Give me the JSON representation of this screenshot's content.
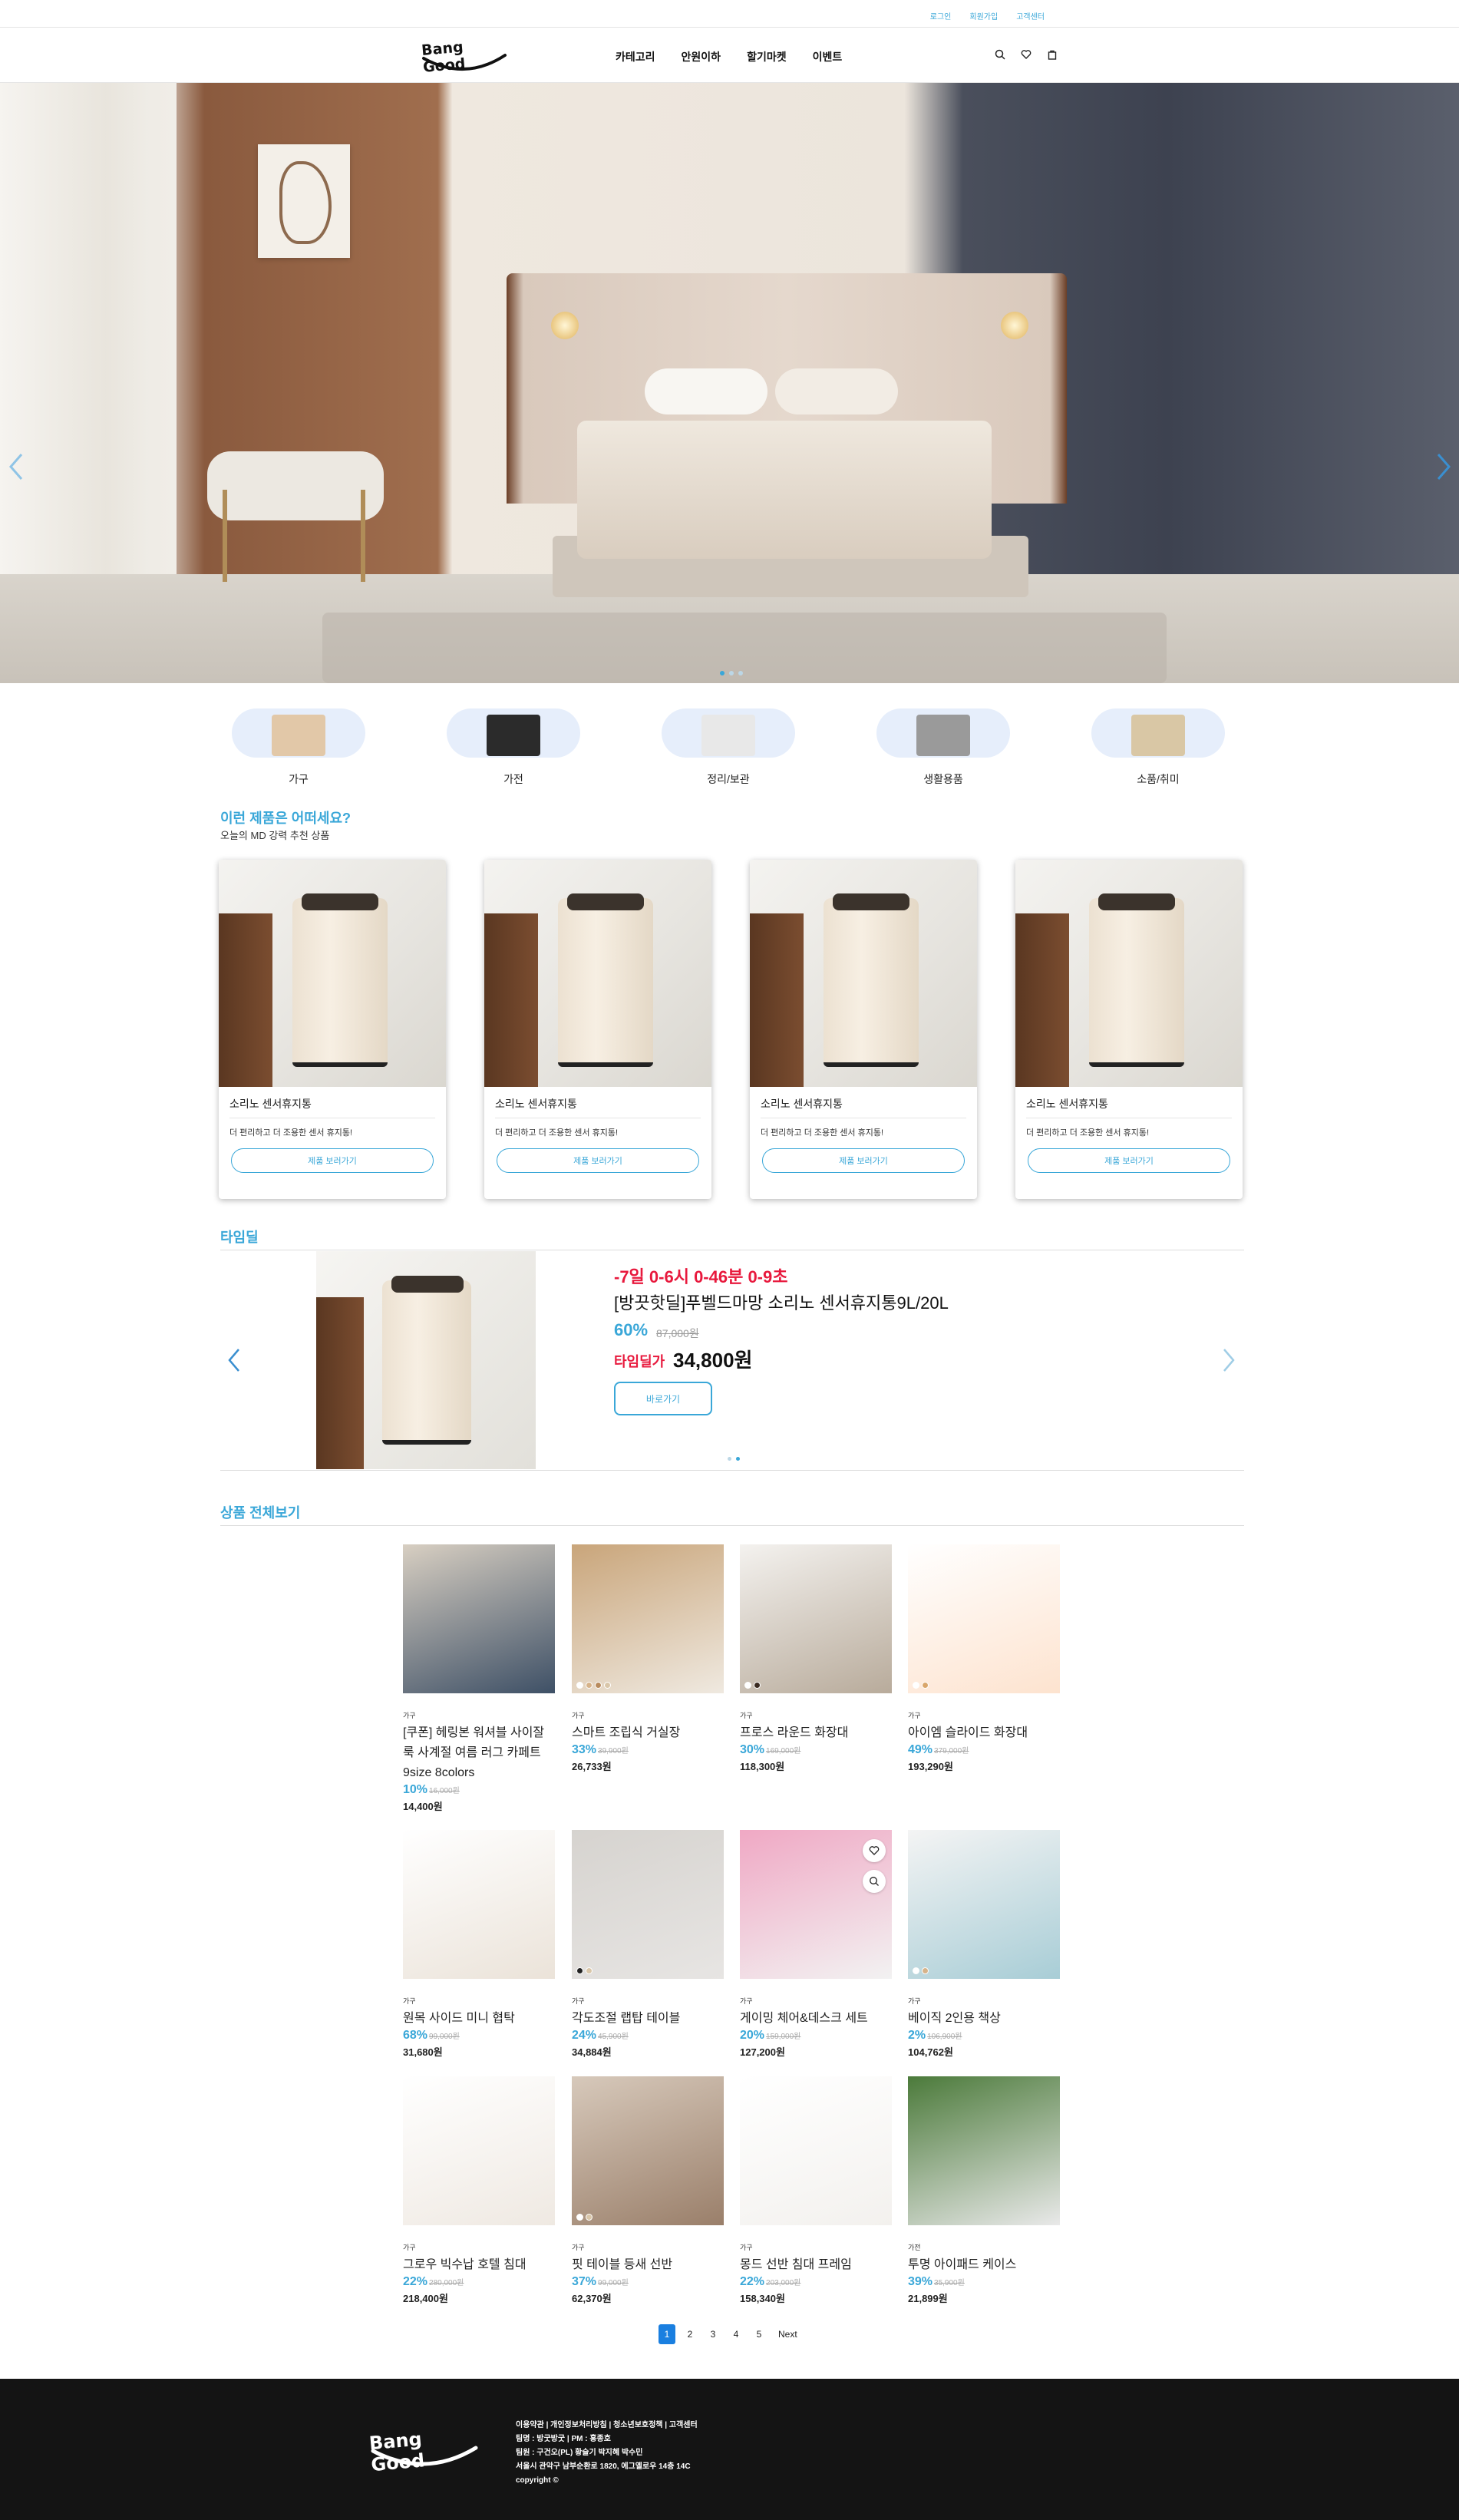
{
  "topbar": {
    "login": "로그인",
    "signup": "회원가입",
    "support": "고객센터"
  },
  "header": {
    "logo": "Bang Good",
    "nav": [
      "카테고리",
      "안원이하",
      "할기마켓",
      "이벤트"
    ],
    "icons": [
      "search-icon",
      "heart-icon",
      "bag-icon"
    ]
  },
  "hero": {
    "slides": 3,
    "active_slide": 1
  },
  "categories": [
    {
      "label": "가구",
      "color": "#e2c8a8"
    },
    {
      "label": "가전",
      "color": "#2b2b2b"
    },
    {
      "label": "정리/보관",
      "color": "#e8e8e8"
    },
    {
      "label": "생활용품",
      "color": "#9a9a9a"
    },
    {
      "label": "소품/취미",
      "color": "#d9c7a5"
    }
  ],
  "md": {
    "title": "이런 제품은 어떠세요?",
    "subtitle": "오늘의 MD 강력 추천 상품",
    "cards": [
      {
        "name": "소리노 센서휴지통",
        "desc": "더 편리하고 더 조용한 센서 휴지통!",
        "button": "제품 보러가기"
      },
      {
        "name": "소리노 센서휴지통",
        "desc": "더 편리하고 더 조용한 센서 휴지통!",
        "button": "제품 보러가기"
      },
      {
        "name": "소리노 센서휴지통",
        "desc": "더 편리하고 더 조용한 센서 휴지통!",
        "button": "제품 보러가기"
      },
      {
        "name": "소리노 센서휴지통",
        "desc": "더 편리하고 더 조용한 센서 휴지통!",
        "button": "제품 보러가기"
      }
    ]
  },
  "timedeal": {
    "title": "타임딜",
    "timer": "-7일 0-6시 0-46분 0-9초",
    "name": "[방끗핫딜]푸벨드마망 소리노 센서휴지통9L/20L",
    "rate": "60%",
    "original": "87,000원",
    "price_label": "타임딜가",
    "price": "34,800원",
    "button": "바로가기",
    "slides": 2,
    "active_slide": 2
  },
  "products": {
    "title": "상품 전체보기",
    "items": [
      {
        "cat": "가구",
        "name": "[쿠폰] 헤링본 워셔블 사이잘룩 사계절 여름 러그 카페트 9size 8colors",
        "rate": "10%",
        "orig": "16,000원",
        "price": "14,400원",
        "c1": "#3e5066",
        "c2": "#d8cfc2",
        "sw": []
      },
      {
        "cat": "가구",
        "name": "스마트 조립식 거실장",
        "rate": "33%",
        "orig": "39,900원",
        "price": "26,733원",
        "c1": "#efe9e0",
        "c2": "#c9a57a",
        "sw": [
          "#ffffff",
          "#d6b38a",
          "#b88b5d",
          "#d9c6a9"
        ]
      },
      {
        "cat": "가구",
        "name": "프로스 라운드 화장대",
        "rate": "30%",
        "orig": "169,000원",
        "price": "118,300원",
        "c1": "#b8ab9b",
        "c2": "#f4f2ef",
        "sw": [
          "#ffffff",
          "#3a2a20"
        ]
      },
      {
        "cat": "가구",
        "name": "아이엠 슬라이드 화장대",
        "rate": "49%",
        "orig": "379,000원",
        "price": "193,290원",
        "c1": "#fde3cf",
        "c2": "#ffffff",
        "sw": [
          "#ffffff",
          "#d9a66b"
        ]
      },
      {
        "cat": "가구",
        "name": "원목 사이드 미니 협탁",
        "rate": "68%",
        "orig": "99,000원",
        "price": "31,680원",
        "c1": "#ebe3d9",
        "c2": "#ffffff",
        "sw": []
      },
      {
        "cat": "가구",
        "name": "각도조절 랩탑 테이블",
        "rate": "24%",
        "orig": "45,900원",
        "price": "34,884원",
        "c1": "#e7e5e3",
        "c2": "#d6d3cf",
        "sw": [
          "#222222",
          "#d9c6a9"
        ]
      },
      {
        "cat": "가구",
        "name": "게이밍 체어&데스크 세트",
        "rate": "20%",
        "orig": "159,000원",
        "price": "127,200원",
        "c1": "#f2f2f2",
        "c2": "#f0a8c4",
        "sw": []
      },
      {
        "cat": "가구",
        "name": "베이직 2인용 책상",
        "rate": "2%",
        "orig": "106,900원",
        "price": "104,762원",
        "c1": "#a8cdd6",
        "c2": "#f4f4f4",
        "sw": [
          "#ffffff",
          "#d6b38a"
        ]
      },
      {
        "cat": "가구",
        "name": "그로우 빅수납 호텔 침대",
        "rate": "22%",
        "orig": "280,000원",
        "price": "218,400원",
        "c1": "#efe9e2",
        "c2": "#ffffff",
        "sw": []
      },
      {
        "cat": "가구",
        "name": "핏 테이블 등새 선반",
        "rate": "37%",
        "orig": "99,000원",
        "price": "62,370원",
        "c1": "#9a7f6a",
        "c2": "#d7c9bb",
        "sw": [
          "#ffffff",
          "#d9c6a9"
        ]
      },
      {
        "cat": "가구",
        "name": "몽드 선반 침대 프레임",
        "rate": "22%",
        "orig": "203,000원",
        "price": "158,340원",
        "c1": "#f3f1ee",
        "c2": "#ffffff",
        "sw": []
      },
      {
        "cat": "가전",
        "name": "투명 아이패드 케이스",
        "rate": "39%",
        "orig": "35,900원",
        "price": "21,899원",
        "c1": "#e9e9e9",
        "c2": "#4b7a3a",
        "sw": []
      }
    ]
  },
  "pager": {
    "pages": [
      "1",
      "2",
      "3",
      "4",
      "5"
    ],
    "next": "Next",
    "active": "1"
  },
  "footer": {
    "logo": "Bang Good",
    "lines": [
      "이용약관 | 개인정보처리방침 | 청소년보호정책 | 고객센터",
      "팀명 : 방굿방굿 | PM : 홍종호",
      "팀원 : 구건오(PL) 황슬기 박지혜 박수민",
      "서울시 관악구 남부순환로 1820, 에그옐로우 14층 14C",
      "copyright ©"
    ]
  },
  "colors": {
    "accent": "#3aa7d8",
    "deal_red": "#e8193d",
    "footer_bg": "#141414"
  }
}
